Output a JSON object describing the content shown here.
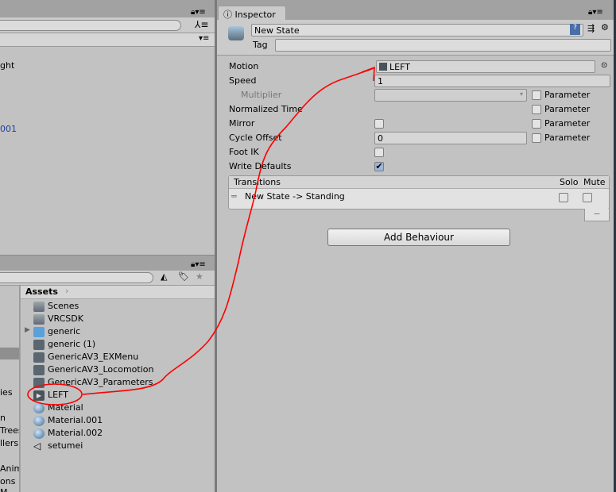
{
  "left_top": {
    "partial_texts": [
      "ght",
      "001"
    ],
    "link_color": "#1a3fa0"
  },
  "inspector": {
    "tab_label": "Inspector",
    "state_name": "New State",
    "tag_label": "Tag",
    "tag_value": "",
    "fields": {
      "motion": {
        "label": "Motion",
        "value": "LEFT"
      },
      "speed": {
        "label": "Speed",
        "value": "1"
      },
      "multiplier": {
        "label": "Multiplier",
        "value": ""
      },
      "normalized_time": {
        "label": "Normalized Time"
      },
      "mirror": {
        "label": "Mirror",
        "checked": false
      },
      "cycle_offset": {
        "label": "Cycle Offset",
        "value": "0"
      },
      "foot_ik": {
        "label": "Foot IK",
        "checked": false
      },
      "write_defaults": {
        "label": "Write Defaults",
        "checked": true
      }
    },
    "parameter_label": "Parameter",
    "transitions": {
      "header": "Transitions",
      "solo": "Solo",
      "mute": "Mute",
      "items": [
        "New State -> Standing"
      ],
      "remove_label": "−"
    },
    "add_behaviour": "Add Behaviour"
  },
  "project": {
    "breadcrumb": "Assets",
    "left_partial": [
      "ies",
      "n",
      "Trees",
      "llers",
      "Anim",
      "ons M"
    ],
    "assets": [
      {
        "name": "Scenes",
        "icon": "folder-icon"
      },
      {
        "name": "VRCSDK",
        "icon": "folder-icon"
      },
      {
        "name": "generic",
        "icon": "model-icon"
      },
      {
        "name": "generic (1)",
        "icon": "animator-controller-icon"
      },
      {
        "name": "GenericAV3_EXMenu",
        "icon": "scriptable-object-icon"
      },
      {
        "name": "GenericAV3_Locomotion",
        "icon": "animator-controller-icon"
      },
      {
        "name": "GenericAV3_Parameters",
        "icon": "scriptable-object-icon"
      },
      {
        "name": "LEFT",
        "icon": "animation-clip-icon"
      },
      {
        "name": "Material",
        "icon": "material-icon"
      },
      {
        "name": "Material.001",
        "icon": "material-icon"
      },
      {
        "name": "Material.002",
        "icon": "material-icon"
      },
      {
        "name": "setumei",
        "icon": "unity-scene-icon"
      }
    ]
  },
  "annotation_color": "#ff0000"
}
